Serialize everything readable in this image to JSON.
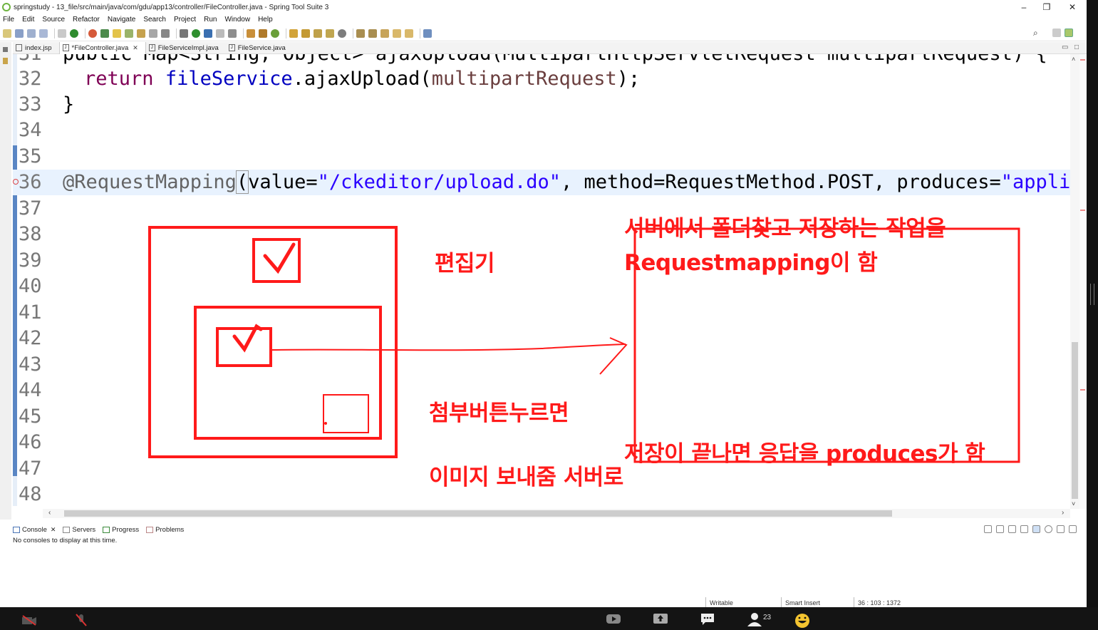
{
  "window": {
    "title": "springstudy - 13_file/src/main/java/com/gdu/app13/controller/FileController.java - Spring Tool Suite 3",
    "minimize": "–",
    "restore": "❐",
    "close": "✕"
  },
  "menu": [
    "File",
    "Edit",
    "Source",
    "Refactor",
    "Navigate",
    "Search",
    "Project",
    "Run",
    "Window",
    "Help"
  ],
  "editor_tabs": [
    {
      "label": "index.jsp",
      "icon": "jsp-file-icon",
      "active": false
    },
    {
      "label": "*FileController.java",
      "icon": "java-file-icon",
      "active": true
    },
    {
      "label": "FileServiceImpl.java",
      "icon": "java-file-icon",
      "active": false
    },
    {
      "label": "FileService.java",
      "icon": "java-file-icon",
      "active": false
    }
  ],
  "code": {
    "partial_line_31": "public Map<String, Object> ajaxUpload(MultipartHttpServletRequest multipartRequest) {",
    "line_numbers": [
      "31",
      "32",
      "33",
      "34",
      "35",
      "36",
      "37",
      "38",
      "39",
      "40",
      "41",
      "42",
      "43",
      "44",
      "45",
      "46",
      "47",
      "48"
    ],
    "line32": {
      "kw": "return",
      "field": "fileService",
      "rest1": ".ajaxUpload(",
      "param": "multipartRequest",
      "rest2": ");"
    },
    "line33": "}",
    "line36": {
      "annotation": "@RequestMapping",
      "open": "(",
      "p1": "value=",
      "s1": "\"/ckeditor/upload.do\"",
      "p2": ", method=RequestMethod.POST, produces=",
      "s2": "\"applica"
    }
  },
  "annotations": {
    "editor_label": "편집기",
    "server_note_1": "서버에서 폴더찾고 저장하는 작업을",
    "server_note_2": "Requestmapping이 함",
    "attach_note_1": "첨부버튼누르면",
    "attach_note_2": "이미지 보내줌 서버로",
    "response_note": "저장이 끝나면 응답을 produces가 함",
    "color": "#ff1a1a"
  },
  "bottom_panel": {
    "tabs": [
      "Console",
      "Servers",
      "Progress",
      "Problems"
    ],
    "message": "No consoles to display at this time."
  },
  "status": {
    "writable": "Writable",
    "insert_mode": "Smart Insert",
    "position": "36 : 103 : 1372"
  },
  "meeting": {
    "participants": "23"
  }
}
